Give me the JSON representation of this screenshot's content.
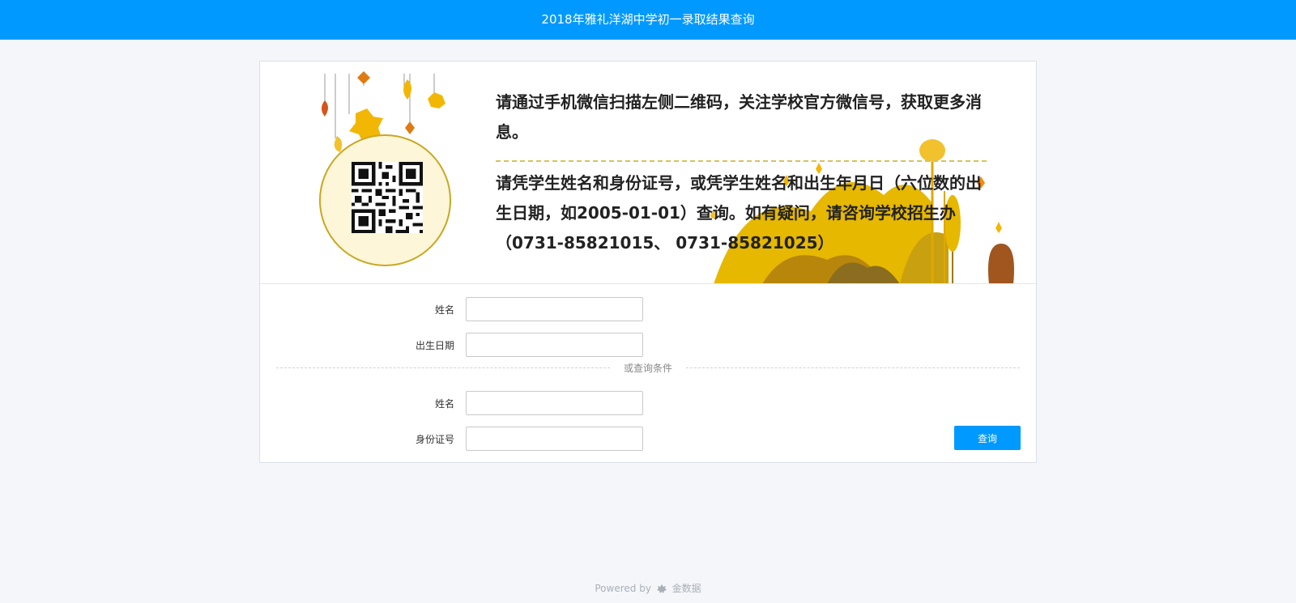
{
  "header": {
    "title": "2018年雅礼洋湖中学初一录取结果查询"
  },
  "banner": {
    "qr_hint": "请通过手机微信扫描左侧二维码，关注学校官方微信号，获取更多消息。",
    "instructions": "请凭学生姓名和身份证号，或凭学生姓名和出生年月日（六位数的出生日期，如2005-01-01）查询。如有疑问，请咨询学校招生办（0731-85821015、 0731-85821025）",
    "qr_icon": "qr-code-icon",
    "colors": {
      "leaf": "#f2b705",
      "leaf_dark": "#e07a12",
      "circle_border": "#c9a722",
      "circle_fill": "#fdf6d8",
      "tree": "#e6b800"
    }
  },
  "form": {
    "group1": {
      "name_label": "姓名",
      "birth_label": "出生日期",
      "name_value": "",
      "birth_value": ""
    },
    "or_text": "或查询条件",
    "group2": {
      "name_label": "姓名",
      "id_label": "身份证号",
      "name_value": "",
      "id_value": ""
    },
    "submit_label": "查询"
  },
  "footer": {
    "powered_by": "Powered by",
    "brand": "金数据",
    "brand_icon": "jinshuju-logo-icon"
  },
  "colors": {
    "primary": "#0099ff",
    "page_bg": "#f4f6f9"
  }
}
